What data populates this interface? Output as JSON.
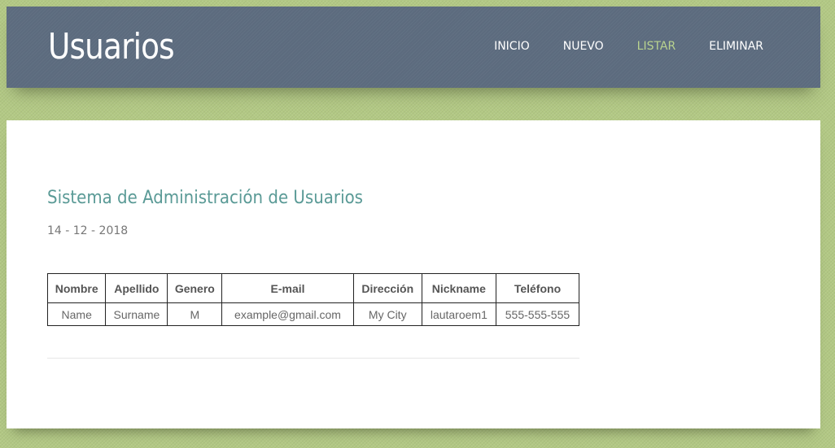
{
  "header": {
    "title": "Usuarios",
    "nav": [
      {
        "label": "INICIO",
        "active": false
      },
      {
        "label": "NUEVO",
        "active": false
      },
      {
        "label": "LISTAR",
        "active": true
      },
      {
        "label": "ELIMINAR",
        "active": false
      }
    ]
  },
  "main": {
    "heading": "Sistema de Administración de Usuarios",
    "date": "14 - 12 - 2018",
    "table": {
      "columns": [
        "Nombre",
        "Apellido",
        "Genero",
        "E-mail",
        "Dirección",
        "Nickname",
        "Teléfono"
      ],
      "rows": [
        [
          "Name",
          "Surname",
          "M",
          "example@gmail.com",
          "My City",
          "lautaroem1",
          "555-555-555"
        ]
      ]
    }
  },
  "colors": {
    "background": "#b3c985",
    "header": "#5c6b7e",
    "accent_nav": "#b9d38f",
    "heading": "#5a9a96"
  }
}
